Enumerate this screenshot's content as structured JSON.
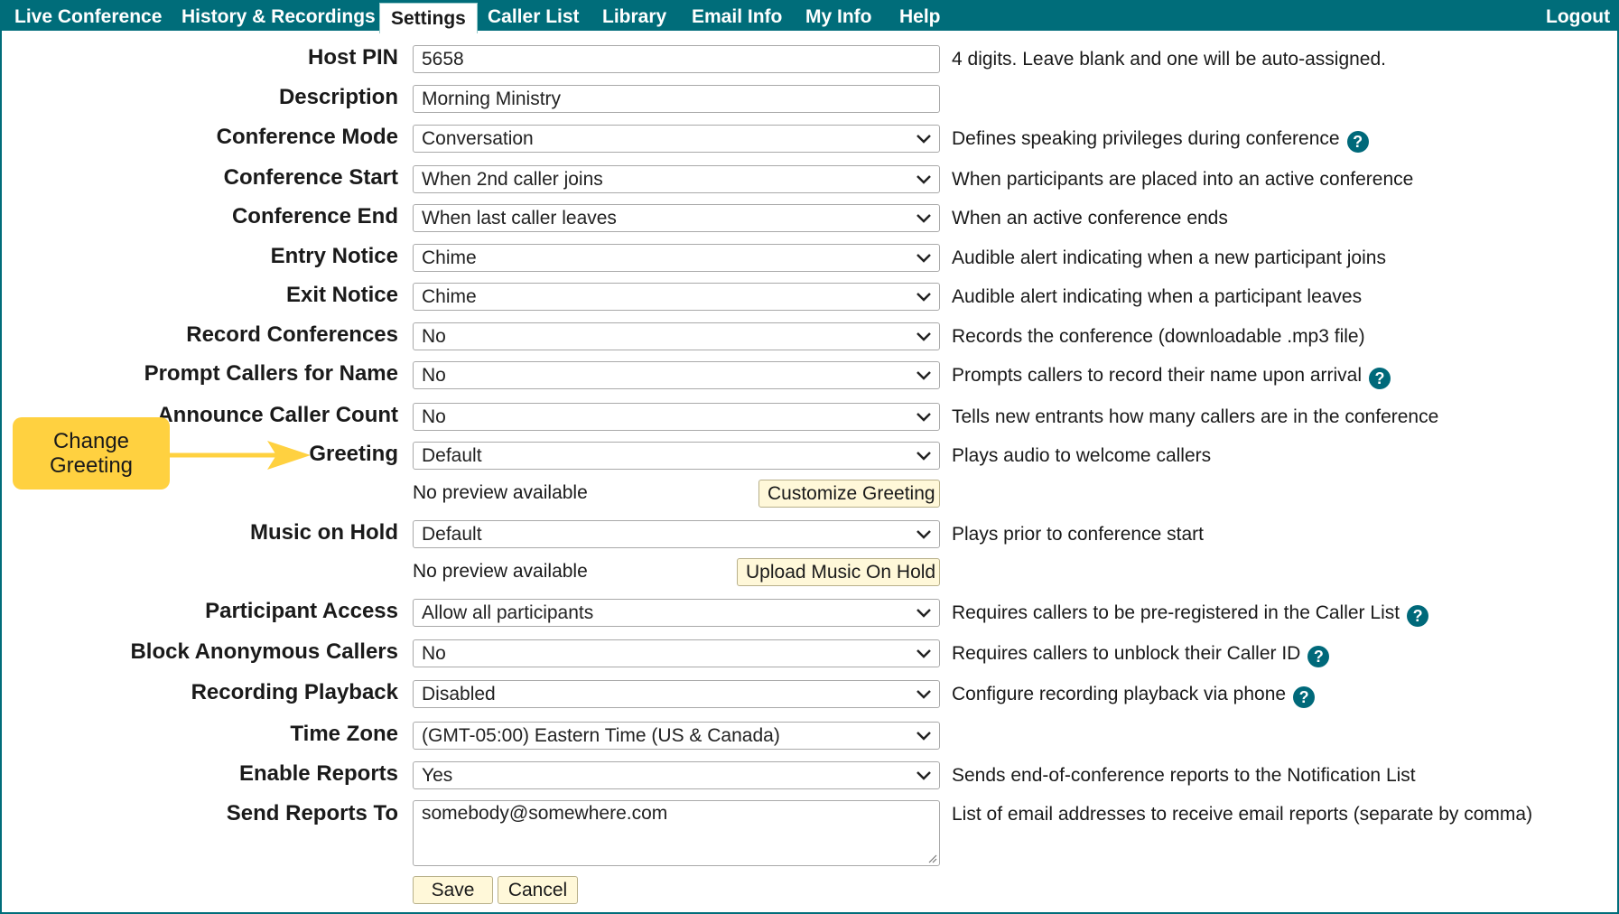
{
  "nav": {
    "items": [
      "Live Conference",
      "History & Recordings",
      "Settings",
      "Caller List",
      "Library",
      "Email Info",
      "My Info",
      "Help"
    ],
    "active": "Settings",
    "logout": "Logout"
  },
  "colors": {
    "nav_bg": "#006d7a",
    "callout_bg": "#ffd140",
    "button_bg": "#fff8d9",
    "help_icon": "#00697a"
  },
  "form": {
    "host_pin": {
      "label": "Host PIN",
      "value": "5658",
      "desc": "4 digits. Leave blank and one will be auto-assigned."
    },
    "description": {
      "label": "Description",
      "value": "Morning Ministry"
    },
    "conference_mode": {
      "label": "Conference Mode",
      "value": "Conversation",
      "desc": "Defines speaking privileges during conference"
    },
    "conference_start": {
      "label": "Conference Start",
      "value": "When 2nd caller joins",
      "desc": "When participants are placed into an active conference"
    },
    "conference_end": {
      "label": "Conference End",
      "value": "When last caller leaves",
      "desc": "When an active conference ends"
    },
    "entry_notice": {
      "label": "Entry Notice",
      "value": "Chime",
      "desc": "Audible alert indicating when a new participant joins"
    },
    "exit_notice": {
      "label": "Exit Notice",
      "value": "Chime",
      "desc": "Audible alert indicating when a participant leaves"
    },
    "record_conferences": {
      "label": "Record Conferences",
      "value": "No",
      "desc": "Records the conference (downloadable .mp3 file)"
    },
    "prompt_callers": {
      "label": "Prompt Callers for Name",
      "value": "No",
      "desc": "Prompts callers to record their name upon arrival"
    },
    "announce_count": {
      "label": "Announce Caller Count",
      "value": "No",
      "desc": "Tells new entrants how many callers are in the conference"
    },
    "greeting": {
      "label": "Greeting",
      "value": "Default",
      "desc": "Plays audio to welcome callers",
      "preview": "No preview available",
      "button": "Customize Greeting"
    },
    "music_on_hold": {
      "label": "Music on Hold",
      "value": "Default",
      "desc": "Plays prior to conference start",
      "preview": "No preview available",
      "button": "Upload Music On Hold"
    },
    "participant_access": {
      "label": "Participant Access",
      "value": "Allow all participants",
      "desc": "Requires callers to be pre-registered in the Caller List"
    },
    "block_anonymous": {
      "label": "Block Anonymous Callers",
      "value": "No",
      "desc": "Requires callers to unblock their Caller ID"
    },
    "recording_playback": {
      "label": "Recording Playback",
      "value": "Disabled",
      "desc": "Configure recording playback via phone"
    },
    "time_zone": {
      "label": "Time Zone",
      "value": "(GMT-05:00) Eastern Time (US & Canada)"
    },
    "enable_reports": {
      "label": "Enable Reports",
      "value": "Yes",
      "desc": "Sends end-of-conference reports to the Notification List"
    },
    "send_reports_to": {
      "label": "Send Reports To",
      "value": "somebody@somewhere.com",
      "desc": "List of email addresses to receive email reports (separate by comma)"
    }
  },
  "actions": {
    "save": "Save",
    "cancel": "Cancel"
  },
  "callout": {
    "line1": "Change",
    "line2": "Greeting"
  },
  "help_glyph": "?"
}
